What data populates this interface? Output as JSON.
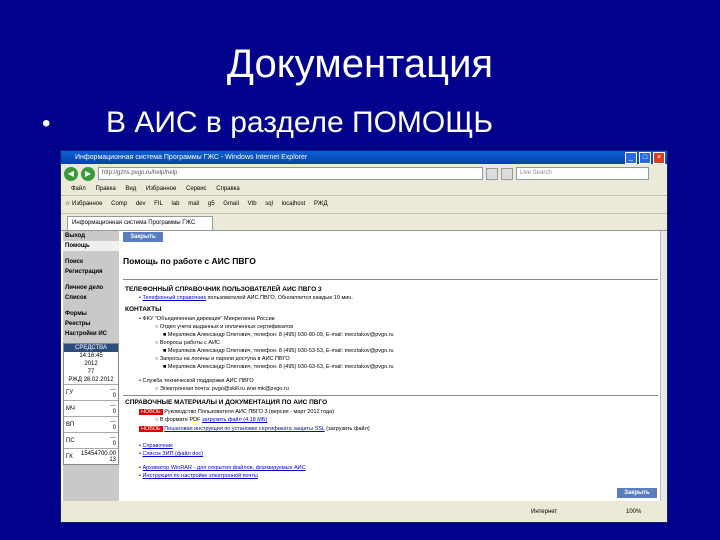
{
  "slide": {
    "title": "Документация",
    "bullet_marker": "•",
    "bullet": "В АИС в разделе ПОМОЩЬ"
  },
  "window": {
    "title": "Информационная система Программы ГЖС - Windows Internet Explorer",
    "address": "http://gzhs.pvgo.ru/help/help",
    "search_placeholder": "Live Search",
    "controls": {
      "minimize": "_",
      "maximize": "□",
      "close": "×"
    }
  },
  "menu": [
    "Файл",
    "Правка",
    "Вид",
    "Избранное",
    "Сервис",
    "Справка"
  ],
  "favorites": [
    "☆ Избранное",
    "Comp",
    "dev",
    "FIL",
    "lab",
    "mail",
    "g5",
    "Gmail",
    "Vtb",
    "sql",
    "localhost",
    "РЖД"
  ],
  "tab": {
    "label": "Информационная система Программы ГЖС"
  },
  "sidebar": {
    "items": [
      "Выход",
      "Помощь",
      "Поиск",
      "Регистрация",
      "Личное дело",
      "Список",
      "Формы",
      "Реестры",
      "Настройки ИС"
    ],
    "active_index": 1,
    "status": {
      "header": "СРЕДСТВА",
      "time": "14:16:45",
      "year": "2012",
      "num": "77",
      "date": "РЖД 28.02.2012",
      "rows": [
        {
          "label": "ГУ",
          "v1": "---",
          "v2": "0"
        },
        {
          "label": "МЧ",
          "v1": "---",
          "v2": "0"
        },
        {
          "label": "ВП",
          "v1": "---",
          "v2": "0"
        },
        {
          "label": "ПС",
          "v1": "---",
          "v2": "0"
        },
        {
          "label": "ГК",
          "v1": "15454700.00",
          "v2": "13"
        }
      ]
    }
  },
  "content": {
    "close_label": "Закрыть",
    "title": "Помощь по работе с АИС ПВГО",
    "phonebook": {
      "heading": "ТЕЛЕФОННЫЙ СПРАВОЧНИК ПОЛЬЗОВАТЕЛЕЙ АИС ПВГО 3",
      "link": "Телефонный справочник",
      "text": "пользователей АИС ПВГО. Обновляется каждые 10 мин."
    },
    "contacts": {
      "heading": "КОНТАКТЫ",
      "org": "ФКУ \"Объединенная дирекция\" Минрегиона России",
      "lines": [
        "Отдел учета выданных и оплаченных сертификатов",
        "Мерзляков Александр Олегович, телефон: 8 (495) 930-80-09, E-mail: merzlakov@pvgo.ru",
        "Вопросы работы с АИС",
        "Мерзляков Александр Олегович, телефон: 8 (495) 930-53-53, E-mail: merzlakov@pvgo.ru",
        "Запросы на логины и пароли доступа в АИС ПВГО",
        "Мерзляков Александр Олегович, телефон: 8 (495) 930-63-63, E-mail: merzlakov@pvgo.ru"
      ],
      "support": "Служба технической поддержки АИС ПВГО",
      "support_email": "Электронная почта: pvgo@skill.ru или mk@pvgo.ru"
    },
    "docs": {
      "heading": "СПРАВОЧНЫЕ МАТЕРИАЛЫ И ДОКУМЕНТАЦИЯ ПО АИС ПВГО",
      "new_badge": "НОВОЕ",
      "doc1": "Руководство Пользователя АИС ПВГО 3 (версия - март 2012 года)",
      "doc1_pdf": "В формате PDF",
      "doc1_link": "загрузить файл (4.18 МБ)",
      "doc2_link": "Пошаговая инструкция по установке сертификата защиты SSL",
      "doc2_text": "(загрузить файл)",
      "ext1": "Справочник",
      "ext2": "Список ЗИП (файл doc)",
      "winrar": "Архиватор WinRAR - для открытия файлов, формируемых АИС",
      "settings": "Инструкция по настройке электронной почты"
    },
    "close_label_bottom": "Закрыть"
  },
  "statusbar": {
    "internet": "Интернет",
    "zoom": "100%"
  }
}
